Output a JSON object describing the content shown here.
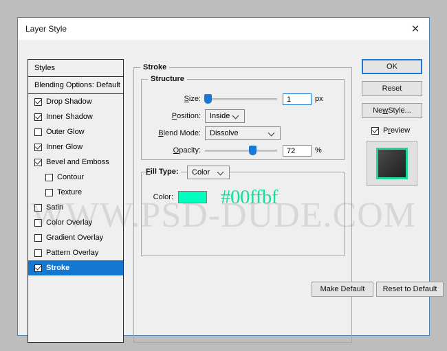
{
  "window": {
    "title": "Layer Style",
    "close_icon": "close-icon"
  },
  "styles_panel": {
    "header": "Styles",
    "blending_options": "Blending Options: Default",
    "items": [
      {
        "label": "Drop Shadow",
        "checked": true,
        "indent": false,
        "selected": false
      },
      {
        "label": "Inner Shadow",
        "checked": true,
        "indent": false,
        "selected": false
      },
      {
        "label": "Outer Glow",
        "checked": false,
        "indent": false,
        "selected": false
      },
      {
        "label": "Inner Glow",
        "checked": true,
        "indent": false,
        "selected": false
      },
      {
        "label": "Bevel and Emboss",
        "checked": true,
        "indent": false,
        "selected": false
      },
      {
        "label": "Contour",
        "checked": false,
        "indent": true,
        "selected": false
      },
      {
        "label": "Texture",
        "checked": false,
        "indent": true,
        "selected": false
      },
      {
        "label": "Satin",
        "checked": false,
        "indent": false,
        "selected": false
      },
      {
        "label": "Color Overlay",
        "checked": false,
        "indent": false,
        "selected": false
      },
      {
        "label": "Gradient Overlay",
        "checked": false,
        "indent": false,
        "selected": false
      },
      {
        "label": "Pattern Overlay",
        "checked": false,
        "indent": false,
        "selected": false
      },
      {
        "label": "Stroke",
        "checked": true,
        "indent": false,
        "selected": true
      }
    ],
    "selected_color": "#1478d2"
  },
  "stroke_panel": {
    "group_title": "Stroke",
    "structure": {
      "title": "Structure",
      "size": {
        "label": "Size:",
        "value": "1",
        "unit": "px",
        "slider_percent": 2
      },
      "position": {
        "label": "Position:",
        "value": "Inside"
      },
      "blend_mode": {
        "label": "Blend Mode:",
        "value": "Dissolve"
      },
      "opacity": {
        "label": "Opacity:",
        "value": "72",
        "unit": "%",
        "slider_percent": 66
      }
    },
    "fill_type": {
      "title": "Fill Type:",
      "value": "Color",
      "color_label": "Color:",
      "color_hex": "#00ffbf",
      "hex_text": "#00ffbf"
    },
    "make_default_label": "Make Default",
    "reset_to_default_label": "Reset to Default"
  },
  "actions": {
    "ok_label": "OK",
    "reset_label": "Reset",
    "new_style_label": "New Style...",
    "preview_label": "Preview",
    "preview_checked": true
  },
  "watermark": {
    "text": "WWW.PSD-DUDE.COM"
  }
}
